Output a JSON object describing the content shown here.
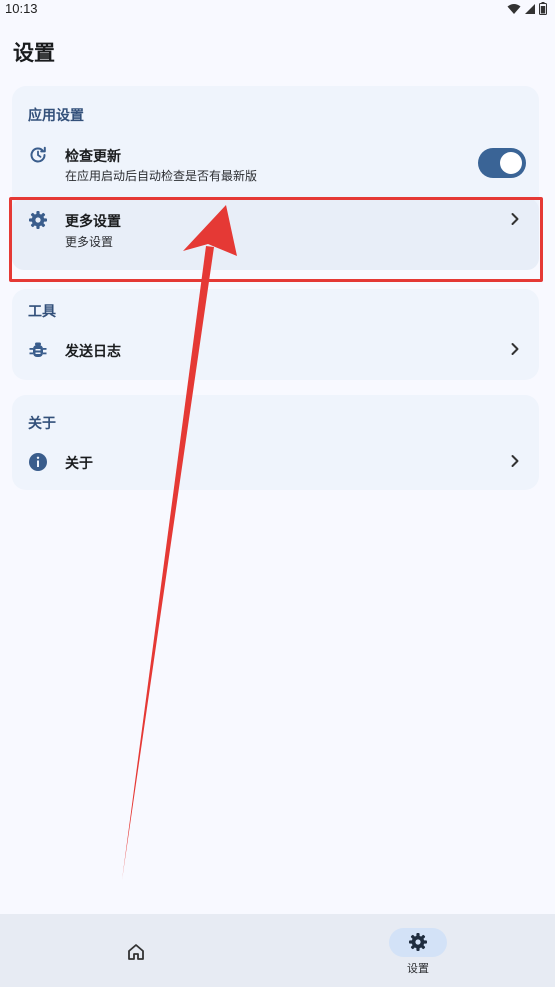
{
  "status_bar": {
    "time": "10:13",
    "icons": [
      "wifi-icon",
      "signal-icon",
      "battery-icon"
    ]
  },
  "page": {
    "title": "设置"
  },
  "sections": {
    "app": {
      "title": "应用设置",
      "check_update": {
        "icon": "update-clock-icon",
        "title": "检查更新",
        "subtitle": "在应用启动后自动检查是否有最新版",
        "toggle_on": true
      },
      "more_settings": {
        "icon": "gear-icon",
        "title": "更多设置",
        "subtitle": "更多设置"
      }
    },
    "tools": {
      "title": "工具",
      "send_log": {
        "icon": "bug-icon",
        "title": "发送日志"
      }
    },
    "about": {
      "title": "关于",
      "about_item": {
        "icon": "info-icon",
        "title": "关于"
      }
    }
  },
  "bottom_nav": {
    "items": [
      {
        "icon": "home-icon",
        "label": "",
        "selected": false
      },
      {
        "icon": "gear-icon",
        "label": "设置",
        "selected": true
      }
    ]
  },
  "colors": {
    "background": "#f8f9ff",
    "card": "#eff4fc",
    "accent": "#3a6496",
    "section_title": "#33507a",
    "annotation_red": "#e53935"
  }
}
